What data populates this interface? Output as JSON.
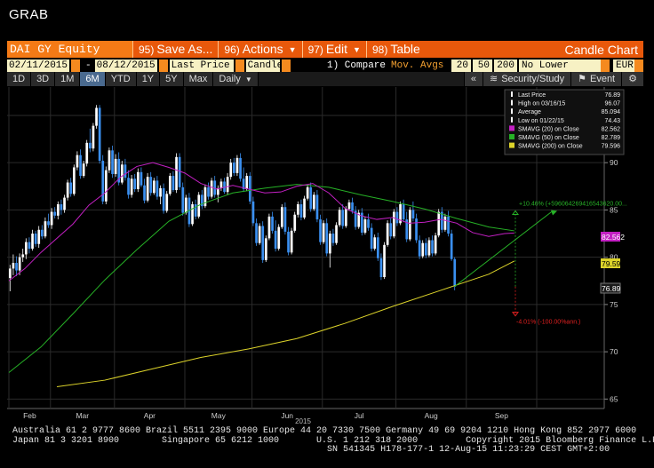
{
  "window": {
    "title": "GRAB"
  },
  "topbar": {
    "ticker": "DAI GY Equity",
    "menus": [
      {
        "num": "95)",
        "label": "Save As..."
      },
      {
        "num": "96)",
        "label": "Actions"
      },
      {
        "num": "97)",
        "label": "Edit"
      },
      {
        "num": "98)",
        "label": "Table"
      }
    ],
    "chart_title": "Candle Chart"
  },
  "params": {
    "start_date": "02/11/2015",
    "dash": "-",
    "end_date": "08/12/2015",
    "price_field": "Last Price",
    "chart_type": "Candle",
    "compare_label": "1) Compare",
    "compare_value": "Mov. Avgs",
    "ma1": "20",
    "ma2": "50",
    "ma3": "200",
    "lower_chart": "No Lower Chart",
    "currency": "EUR"
  },
  "periods": {
    "items": [
      "1D",
      "3D",
      "1M",
      "6M",
      "YTD",
      "1Y",
      "5Y",
      "Max"
    ],
    "active": "6M",
    "frequency": "Daily",
    "collapse": "«",
    "security_study": "Security/Study",
    "event": "Event",
    "settings_icon": "gear-icon"
  },
  "legend": {
    "rows": [
      {
        "label": "Last Price",
        "value": "76.89"
      },
      {
        "label": "High on 03/16/15",
        "value": "96.07"
      },
      {
        "label": "Average",
        "value": "85.094"
      },
      {
        "label": "Low on 01/22/15",
        "value": "74.43"
      },
      {
        "label": "SMAVG (20) on Close",
        "value": "82.562"
      },
      {
        "label": "SMAVG (50) on Close",
        "value": "82.789"
      },
      {
        "label": "SMAVG (200) on Close",
        "value": "79.596"
      }
    ]
  },
  "annotations": {
    "up": "+10.46% (+59606426941654362​0.00...",
    "down": "-4.01% (-100.00%ann.)"
  },
  "price_tags": {
    "sma20": "82.562",
    "sma200": "79.596",
    "last": "76.89"
  },
  "footer": {
    "line1": "Australia 61 2 9777 8600 Brazil 5511 2395 9000 Europe 44 20 7330 7500 Germany 49 69 9204 1210 Hong Kong 852 2977 6000",
    "line2": "Japan 81 3 3201 8900        Singapore 65 6212 1000       U.S. 1 212 318 2000         Copyright 2015 Bloomberg Finance L.P.",
    "line3": "                                                           SN 541345 H178-177-1 12-Aug-15 11:23:29 CEST GMT+2:00"
  },
  "colors": {
    "orange": "#e8580b",
    "candle_up": "#ffffff",
    "candle_down": "#3a8ff0",
    "sma20": "#c21fc2",
    "sma50": "#26b126",
    "sma200": "#dcd32a",
    "grid": "#2b2b2b"
  },
  "chart_data": {
    "type": "candlestick",
    "x_labels": [
      "Feb",
      "Mar",
      "Apr",
      "May",
      "Jun",
      "Jul",
      "Aug",
      "Sep"
    ],
    "year_label": "2015",
    "y_ticks": [
      65,
      70,
      75,
      80,
      85,
      90,
      95
    ],
    "ylim": [
      64,
      98
    ],
    "last_price": 76.89,
    "high": 96.07,
    "average": 85.094,
    "low": 74.43,
    "sma20": [
      [
        0,
        77.5
      ],
      [
        5,
        78.8
      ],
      [
        10,
        80.5
      ],
      [
        15,
        82.0
      ],
      [
        20,
        83.5
      ],
      [
        25,
        85.5
      ],
      [
        30,
        86.8
      ],
      [
        35,
        88.5
      ],
      [
        40,
        89.6
      ],
      [
        45,
        90.0
      ],
      [
        50,
        89.5
      ],
      [
        55,
        88.9
      ],
      [
        60,
        87.8
      ],
      [
        65,
        87.2
      ],
      [
        70,
        87.6
      ],
      [
        75,
        87.2
      ],
      [
        80,
        86.8
      ],
      [
        85,
        86.9
      ],
      [
        90,
        87.5
      ],
      [
        95,
        87.8
      ],
      [
        100,
        86.8
      ],
      [
        105,
        85.2
      ],
      [
        110,
        84.4
      ],
      [
        115,
        84.0
      ],
      [
        120,
        84.2
      ],
      [
        125,
        83.6
      ],
      [
        130,
        83.7
      ],
      [
        135,
        84.0
      ],
      [
        140,
        83.6
      ],
      [
        145,
        82.6
      ],
      [
        150,
        82.2
      ],
      [
        155,
        82.5
      ],
      [
        158,
        82.56
      ]
    ],
    "sma50": [
      [
        0,
        67.8
      ],
      [
        10,
        70.5
      ],
      [
        20,
        74.0
      ],
      [
        30,
        77.6
      ],
      [
        40,
        80.8
      ],
      [
        50,
        83.8
      ],
      [
        60,
        85.6
      ],
      [
        70,
        86.8
      ],
      [
        80,
        87.3
      ],
      [
        90,
        87.7
      ],
      [
        100,
        87.4
      ],
      [
        110,
        86.6
      ],
      [
        120,
        85.9
      ],
      [
        130,
        85.1
      ],
      [
        140,
        84.1
      ],
      [
        150,
        83.2
      ],
      [
        158,
        82.79
      ]
    ],
    "sma200": [
      [
        15,
        66.3
      ],
      [
        30,
        67.0
      ],
      [
        45,
        68.2
      ],
      [
        60,
        69.4
      ],
      [
        75,
        70.3
      ],
      [
        90,
        71.4
      ],
      [
        105,
        73.0
      ],
      [
        120,
        74.8
      ],
      [
        135,
        76.5
      ],
      [
        150,
        78.2
      ],
      [
        158,
        79.6
      ]
    ],
    "candles": [
      [
        77.8,
        79.2,
        76.4,
        78.8
      ],
      [
        78.8,
        80.3,
        78.1,
        79.4
      ],
      [
        79.4,
        80.1,
        78.0,
        78.6
      ],
      [
        78.6,
        80.4,
        78.1,
        80.0
      ],
      [
        80.0,
        80.9,
        79.5,
        80.3
      ],
      [
        80.3,
        82.0,
        79.8,
        81.6
      ],
      [
        81.6,
        82.1,
        80.4,
        80.9
      ],
      [
        80.9,
        82.9,
        80.7,
        82.5
      ],
      [
        82.5,
        82.8,
        81.1,
        81.4
      ],
      [
        81.4,
        83.3,
        81.0,
        82.9
      ],
      [
        82.9,
        83.4,
        81.9,
        82.2
      ],
      [
        82.2,
        84.2,
        82.0,
        83.8
      ],
      [
        83.8,
        84.6,
        83.1,
        83.4
      ],
      [
        83.4,
        85.2,
        83.0,
        84.8
      ],
      [
        84.8,
        85.3,
        84.1,
        84.4
      ],
      [
        84.4,
        85.9,
        84.0,
        85.6
      ],
      [
        85.6,
        86.1,
        84.5,
        85.0
      ],
      [
        85.0,
        86.6,
        84.7,
        86.3
      ],
      [
        86.3,
        88.2,
        86.0,
        87.9
      ],
      [
        87.9,
        88.4,
        86.4,
        86.7
      ],
      [
        86.7,
        89.8,
        86.5,
        89.5
      ],
      [
        89.5,
        91.2,
        89.2,
        90.8
      ],
      [
        90.8,
        91.4,
        88.3,
        88.6
      ],
      [
        88.6,
        90.2,
        88.4,
        89.9
      ],
      [
        89.9,
        92.4,
        89.6,
        92.1
      ],
      [
        92.1,
        93.6,
        91.1,
        91.5
      ],
      [
        91.5,
        94.2,
        91.2,
        93.9
      ],
      [
        93.9,
        96.1,
        93.6,
        95.8
      ],
      [
        95.8,
        96.1,
        89.9,
        90.2
      ],
      [
        90.2,
        90.8,
        85.6,
        85.9
      ],
      [
        85.9,
        89.6,
        85.6,
        89.2
      ],
      [
        89.2,
        91.6,
        88.9,
        91.3
      ],
      [
        91.3,
        91.8,
        88.4,
        88.8
      ],
      [
        88.8,
        90.9,
        88.5,
        90.4
      ],
      [
        90.4,
        91.1,
        87.6,
        87.9
      ],
      [
        87.9,
        90.2,
        87.7,
        89.8
      ],
      [
        89.8,
        90.4,
        88.1,
        88.4
      ],
      [
        88.4,
        89.2,
        86.2,
        86.6
      ],
      [
        86.6,
        88.7,
        86.3,
        88.3
      ],
      [
        88.3,
        88.8,
        86.9,
        87.2
      ],
      [
        87.2,
        89.4,
        86.9,
        89.0
      ],
      [
        89.0,
        89.5,
        87.4,
        87.6
      ],
      [
        87.6,
        88.3,
        85.7,
        86.0
      ],
      [
        86.0,
        88.9,
        85.8,
        88.5
      ],
      [
        88.5,
        89.0,
        86.5,
        86.8
      ],
      [
        86.8,
        88.4,
        86.6,
        88.1
      ],
      [
        88.1,
        88.6,
        86.1,
        86.4
      ],
      [
        86.4,
        87.6,
        85.6,
        87.3
      ],
      [
        87.3,
        87.8,
        84.6,
        84.9
      ],
      [
        84.9,
        87.0,
        84.7,
        86.7
      ],
      [
        86.7,
        88.9,
        86.5,
        88.6
      ],
      [
        88.6,
        89.1,
        86.9,
        87.1
      ],
      [
        87.1,
        91.0,
        86.8,
        90.6
      ],
      [
        90.6,
        91.0,
        87.1,
        87.4
      ],
      [
        87.4,
        87.9,
        84.4,
        84.7
      ],
      [
        84.7,
        86.6,
        84.5,
        86.3
      ],
      [
        86.3,
        86.8,
        83.2,
        83.5
      ],
      [
        83.5,
        85.9,
        83.3,
        85.6
      ],
      [
        85.6,
        86.1,
        84.0,
        84.3
      ],
      [
        84.3,
        86.9,
        84.1,
        86.6
      ],
      [
        86.6,
        87.1,
        85.1,
        85.4
      ],
      [
        85.4,
        87.7,
        85.2,
        87.4
      ],
      [
        87.4,
        87.9,
        86.1,
        86.4
      ],
      [
        86.4,
        88.4,
        86.2,
        88.1
      ],
      [
        88.1,
        88.6,
        86.3,
        86.6
      ],
      [
        86.6,
        87.6,
        85.8,
        87.3
      ],
      [
        87.3,
        88.3,
        87.0,
        88.0
      ],
      [
        88.0,
        88.4,
        86.7,
        86.9
      ],
      [
        86.9,
        88.9,
        86.6,
        88.5
      ],
      [
        88.5,
        90.4,
        88.2,
        90.0
      ],
      [
        90.0,
        90.5,
        88.6,
        88.9
      ],
      [
        88.9,
        90.8,
        88.6,
        90.5
      ],
      [
        90.5,
        91.0,
        88.0,
        88.3
      ],
      [
        88.3,
        89.5,
        86.9,
        87.2
      ],
      [
        87.2,
        88.9,
        87.0,
        88.6
      ],
      [
        88.6,
        89.0,
        85.6,
        85.9
      ],
      [
        85.9,
        86.4,
        83.3,
        83.6
      ],
      [
        83.6,
        84.1,
        81.2,
        81.5
      ],
      [
        81.5,
        83.6,
        81.3,
        83.3
      ],
      [
        83.3,
        83.8,
        79.4,
        79.7
      ],
      [
        79.7,
        82.3,
        79.5,
        82.0
      ],
      [
        82.0,
        84.6,
        81.8,
        84.3
      ],
      [
        84.3,
        84.8,
        82.5,
        82.8
      ],
      [
        82.8,
        83.9,
        80.6,
        80.9
      ],
      [
        80.9,
        83.5,
        80.7,
        83.2
      ],
      [
        83.2,
        85.6,
        83.0,
        85.3
      ],
      [
        85.3,
        85.8,
        82.4,
        82.7
      ],
      [
        82.7,
        83.2,
        80.2,
        80.5
      ],
      [
        80.5,
        83.1,
        80.3,
        82.8
      ],
      [
        82.8,
        84.8,
        82.6,
        84.5
      ],
      [
        84.5,
        85.9,
        84.2,
        85.6
      ],
      [
        85.6,
        86.1,
        83.9,
        84.2
      ],
      [
        84.2,
        86.5,
        84.0,
        86.2
      ],
      [
        86.2,
        87.7,
        86.0,
        87.4
      ],
      [
        87.4,
        87.9,
        84.8,
        85.1
      ],
      [
        85.1,
        86.9,
        84.9,
        86.6
      ],
      [
        86.6,
        87.1,
        83.7,
        84.0
      ],
      [
        84.0,
        84.5,
        81.3,
        81.6
      ],
      [
        81.6,
        83.9,
        81.4,
        83.6
      ],
      [
        83.6,
        84.1,
        80.1,
        80.4
      ],
      [
        80.4,
        82.8,
        78.9,
        82.5
      ],
      [
        82.5,
        83.0,
        81.2,
        81.5
      ],
      [
        81.5,
        83.7,
        81.3,
        83.4
      ],
      [
        83.4,
        85.3,
        83.2,
        85.0
      ],
      [
        85.0,
        85.6,
        83.0,
        83.3
      ],
      [
        83.3,
        85.4,
        83.1,
        85.1
      ],
      [
        85.1,
        86.1,
        84.9,
        85.8
      ],
      [
        85.8,
        86.3,
        84.6,
        84.9
      ],
      [
        84.9,
        85.4,
        82.9,
        83.2
      ],
      [
        83.2,
        85.0,
        83.0,
        84.7
      ],
      [
        84.7,
        85.2,
        82.3,
        82.6
      ],
      [
        82.6,
        84.3,
        82.4,
        84.0
      ],
      [
        84.0,
        84.6,
        82.8,
        83.1
      ],
      [
        83.1,
        83.6,
        80.6,
        80.9
      ],
      [
        80.9,
        82.4,
        80.7,
        82.1
      ],
      [
        82.1,
        82.6,
        79.6,
        79.9
      ],
      [
        79.9,
        80.4,
        77.6,
        77.9
      ],
      [
        77.9,
        81.6,
        77.7,
        81.3
      ],
      [
        81.3,
        83.9,
        81.1,
        83.6
      ],
      [
        83.6,
        84.1,
        81.9,
        82.2
      ],
      [
        82.2,
        85.1,
        82.0,
        84.8
      ],
      [
        84.8,
        85.3,
        83.3,
        83.6
      ],
      [
        83.6,
        85.9,
        83.4,
        85.6
      ],
      [
        85.6,
        86.1,
        83.7,
        84.0
      ],
      [
        84.0,
        84.8,
        81.6,
        81.9
      ],
      [
        81.9,
        85.3,
        81.7,
        85.0
      ],
      [
        85.0,
        85.9,
        83.8,
        84.1
      ],
      [
        84.1,
        84.6,
        81.5,
        81.8
      ],
      [
        81.8,
        82.3,
        79.8,
        80.1
      ],
      [
        80.1,
        81.8,
        79.9,
        81.5
      ],
      [
        81.5,
        82.0,
        79.9,
        80.2
      ],
      [
        80.2,
        82.1,
        80.0,
        81.8
      ],
      [
        81.8,
        82.3,
        80.1,
        80.4
      ],
      [
        80.4,
        82.6,
        80.2,
        82.3
      ],
      [
        82.3,
        85.1,
        82.1,
        84.8
      ],
      [
        84.8,
        85.3,
        82.6,
        82.9
      ],
      [
        82.9,
        84.6,
        82.7,
        84.3
      ],
      [
        84.3,
        84.9,
        82.2,
        82.5
      ],
      [
        82.5,
        82.9,
        79.6,
        79.8
      ],
      [
        79.8,
        80.0,
        76.5,
        76.89
      ]
    ]
  }
}
